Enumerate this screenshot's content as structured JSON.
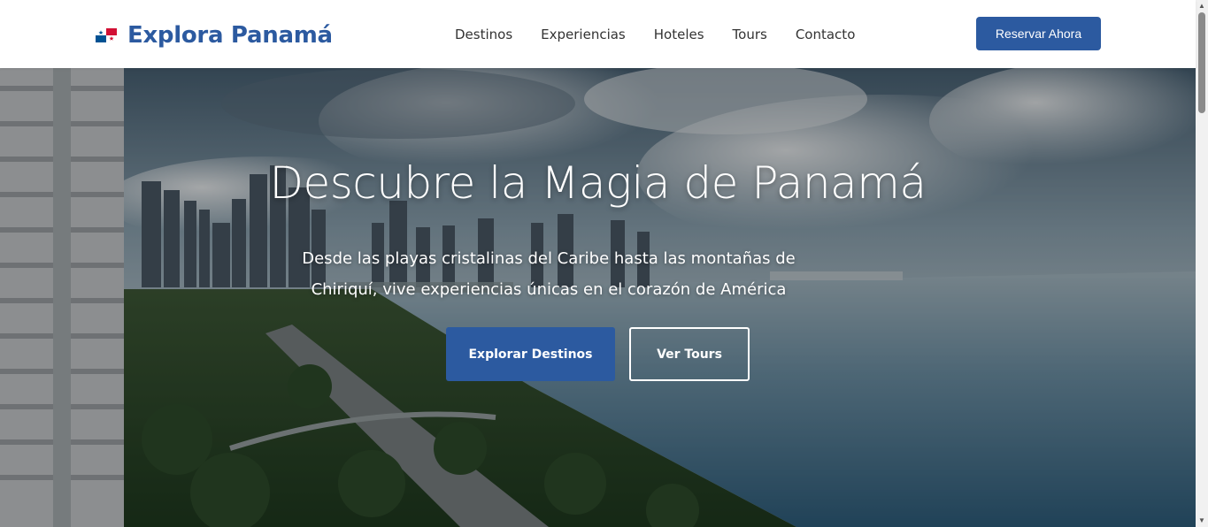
{
  "header": {
    "brand": "Explora Panamá",
    "nav": [
      {
        "label": "Destinos"
      },
      {
        "label": "Experiencias"
      },
      {
        "label": "Hoteles"
      },
      {
        "label": "Tours"
      },
      {
        "label": "Contacto"
      }
    ],
    "cta_label": "Reservar Ahora"
  },
  "hero": {
    "title": "Descubre la Magia de Panamá",
    "subtitle": "Desde las playas cristalinas del Caribe hasta las montañas de Chiriquí, vive experiencias únicas en el corazón de América",
    "primary_button": "Explorar Destinos",
    "secondary_button": "Ver Tours"
  },
  "icons": {
    "brand": "panama-flag-icon",
    "scroll_up": "chevron-up-icon",
    "scroll_down": "chevron-down-icon"
  },
  "colors": {
    "brand_primary": "#2c5aa0",
    "nav_text": "#333333",
    "hero_text": "#ffffff",
    "flag_red": "#d21034",
    "flag_blue": "#005293"
  }
}
